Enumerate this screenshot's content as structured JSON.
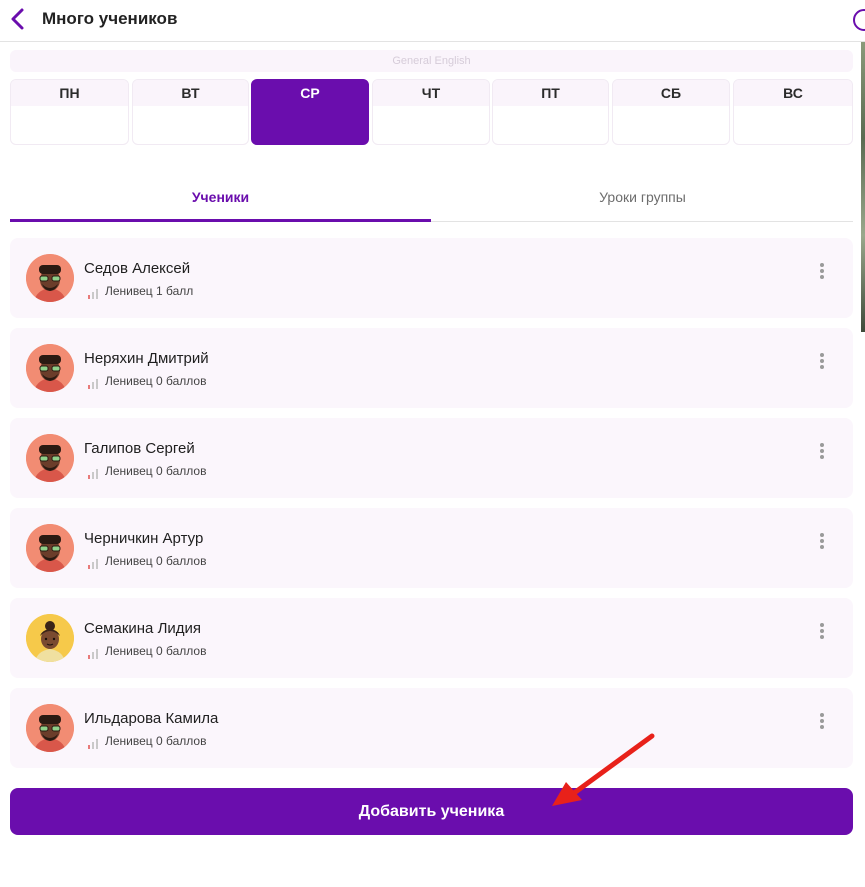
{
  "header": {
    "title": "Много учеников"
  },
  "course": {
    "name": "General English"
  },
  "days": [
    {
      "label": "ПН",
      "active": false
    },
    {
      "label": "ВТ",
      "active": false
    },
    {
      "label": "СР",
      "active": true
    },
    {
      "label": "ЧТ",
      "active": false
    },
    {
      "label": "ПТ",
      "active": false
    },
    {
      "label": "СБ",
      "active": false
    },
    {
      "label": "ВС",
      "active": false
    }
  ],
  "tabs": {
    "students": "Ученики",
    "lessons": "Уроки группы",
    "active": "students"
  },
  "students": [
    {
      "name": "Седов Алексей",
      "rank": "Ленивец 1 балл",
      "avatar": "male-avatar"
    },
    {
      "name": "Неряхин Дмитрий",
      "rank": "Ленивец 0 баллов",
      "avatar": "male-avatar"
    },
    {
      "name": "Галипов Сергей",
      "rank": "Ленивец 0 баллов",
      "avatar": "male-avatar"
    },
    {
      "name": "Черничкин Артур",
      "rank": "Ленивец 0 баллов",
      "avatar": "male-avatar"
    },
    {
      "name": "Семакина Лидия",
      "rank": "Ленивец 0 баллов",
      "avatar": "female-avatar"
    },
    {
      "name": "Ильдарова Камила",
      "rank": "Ленивец 0 баллов",
      "avatar": "male-avatar"
    }
  ],
  "actions": {
    "add_student": "Добавить ученика"
  },
  "colors": {
    "accent": "#6a0dad",
    "card_bg": "#fbf6fc",
    "annotation_arrow": "#e8211a"
  }
}
